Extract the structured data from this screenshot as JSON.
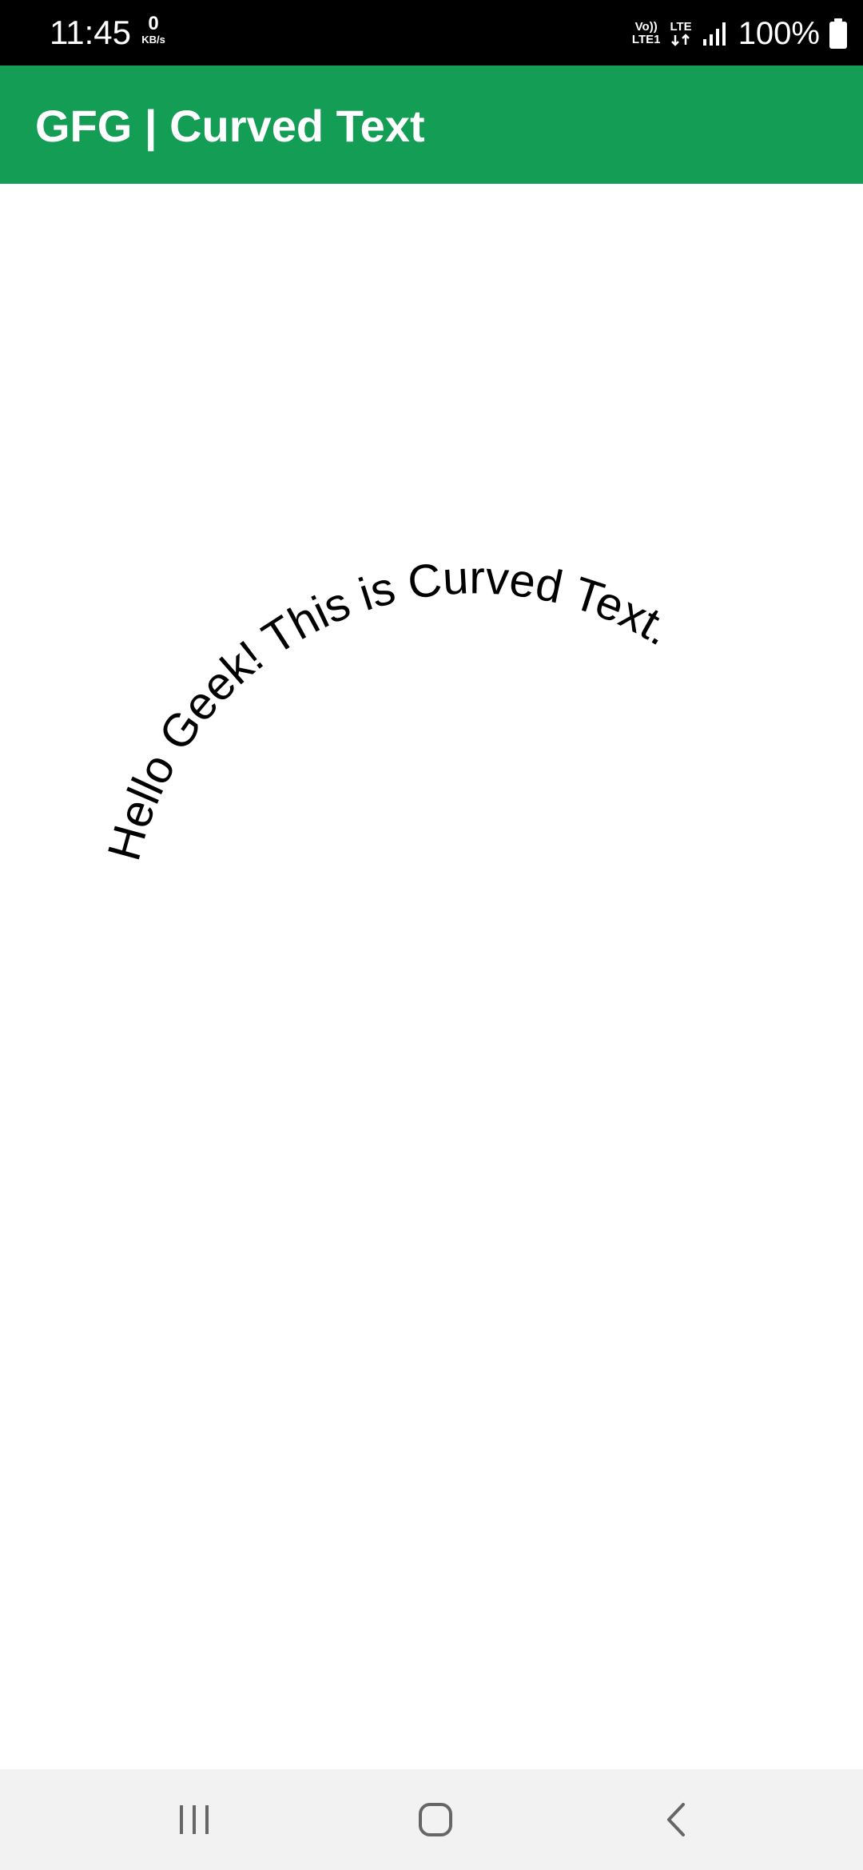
{
  "status_bar": {
    "time": "11:45",
    "speed_value": "0",
    "speed_unit": "KB/s",
    "volte_top": "Vo))",
    "volte_bottom": "LTE1",
    "lte_label": "LTE",
    "battery_percent": "100%"
  },
  "app_bar": {
    "title": "GFG | Curved Text",
    "background_color": "#139d55"
  },
  "content": {
    "curved_text": "Hello Geek! This is Curved Text."
  },
  "nav_bar": {
    "recents_icon": "recents-icon",
    "home_icon": "home-icon",
    "back_icon": "back-icon"
  }
}
